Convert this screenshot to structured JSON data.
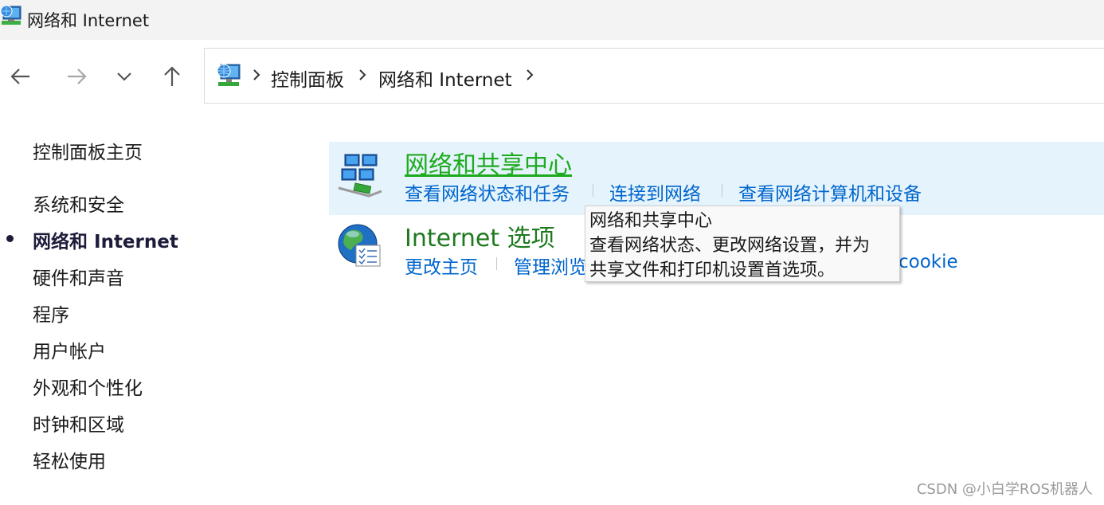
{
  "window": {
    "title": "网络和 Internet"
  },
  "navigation": {
    "back_icon": "back-arrow-icon",
    "forward_icon": "forward-arrow-icon",
    "recent_icon": "chevron-down-icon",
    "up_icon": "up-arrow-icon"
  },
  "address": {
    "icon": "network-globe-icon",
    "crumbs": [
      "控制面板",
      "网络和 Internet"
    ]
  },
  "sidebar": {
    "home": "控制面板主页",
    "items": [
      {
        "label": "系统和安全",
        "active": false
      },
      {
        "label": "网络和 Internet",
        "active": true
      },
      {
        "label": "硬件和声音",
        "active": false
      },
      {
        "label": "程序",
        "active": false
      },
      {
        "label": "用户帐户",
        "active": false
      },
      {
        "label": "外观和个性化",
        "active": false
      },
      {
        "label": "时钟和区域",
        "active": false
      },
      {
        "label": "轻松使用",
        "active": false
      }
    ]
  },
  "categories": [
    {
      "title": "网络和共享中心",
      "icon": "network-sharing-center-icon",
      "links": [
        "查看网络状态和任务",
        "连接到网络",
        "查看网络计算机和设备"
      ]
    },
    {
      "title": "Internet 选项",
      "icon": "internet-options-globe-icon",
      "links": [
        "更改主页",
        "管理浏览",
        "cookie"
      ]
    }
  ],
  "tooltip": {
    "lines": [
      "网络和共享中心",
      "查看网络状态、更改网络设置，并为",
      "共享文件和打印机设置首选项。"
    ]
  },
  "watermark": "CSDN @小白学ROS机器人",
  "colors": {
    "link": "#0066cc",
    "category_title": "#1e7a1e",
    "hover_background": "#e5f3fd"
  }
}
